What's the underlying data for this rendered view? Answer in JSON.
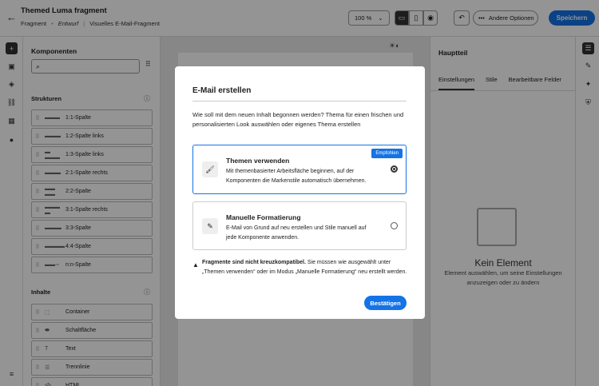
{
  "header": {
    "title": "Themed Luma fragment",
    "crumb_type": "Fragment",
    "status": "Entwurf",
    "crumb_kind": "Visuelles E-Mail-Fragment",
    "zoom": "100 %",
    "more_options": "Andere Optionen",
    "save": "Speichern"
  },
  "components": {
    "title": "Komponenten",
    "structures_label": "Strukturen",
    "structures": [
      {
        "glyph": "▬▬▬",
        "label": "1:1-Spalte"
      },
      {
        "glyph": "▬ ▬▬",
        "label": "1:2-Spalte links"
      },
      {
        "glyph": "▬ ▬▬▬",
        "label": "1:3-Spalte links"
      },
      {
        "glyph": "▬▬ ▬",
        "label": "2:1-Spalte rechts"
      },
      {
        "glyph": "▬▬ ▬▬",
        "label": "2:2-Spalte"
      },
      {
        "glyph": "▬▬▬ ▬",
        "label": "3:1-Spalte rechts"
      },
      {
        "glyph": "▬ ▬ ▬",
        "label": "3:3-Spalte"
      },
      {
        "glyph": "▬▬▬▬",
        "label": "4:4-Spalte"
      },
      {
        "glyph": "▬▬ ▫ ▫",
        "label": "n:n-Spalte"
      }
    ],
    "contents_label": "Inhalte",
    "contents": [
      {
        "glyph": "⬚",
        "label": "Container"
      },
      {
        "glyph": "⬬",
        "label": "Schaltfläche"
      },
      {
        "glyph": "T",
        "label": "Text"
      },
      {
        "glyph": "☰",
        "label": "Trennlinie"
      },
      {
        "glyph": "</>",
        "label": "HTML"
      }
    ]
  },
  "right_panel": {
    "title": "Hauptteil",
    "tabs": [
      "Einstellungen",
      "Stile",
      "Bearbeitbare Felder"
    ],
    "empty_title": "Kein Element",
    "empty_text": "Element auswählen, um seine Einstellungen anzuzeigen oder zu ändern"
  },
  "dialog": {
    "title": "E-Mail erstellen",
    "description": "Wie soll mit dem neuen Inhalt begonnen werden? Thema für einen frischen und personalisierten Look auswählen oder eigenes Thema erstellen",
    "option1_title": "Themen verwenden",
    "option1_text": "Mit themenbasierter Arbeitsfläche beginnen, auf der Komponenten die Markenstile automatisch übernehmen.",
    "option1_badge": "Empfohlen",
    "option2_title": "Manuelle Formatierung",
    "option2_text": "E-Mail von Grund auf neu erstellen und Stile manuell auf jede Komponente anwenden.",
    "warning_bold": "Fragmente sind nicht kreuzkompatibel.",
    "warning_text": " Sie müssen wie ausgewählt unter „Themen verwenden“ oder im Modus „Manuelle Formatierung“ neu erstellt werden.",
    "confirm": "Bestätigen"
  },
  "colors": {
    "accent": "#1473e6"
  }
}
